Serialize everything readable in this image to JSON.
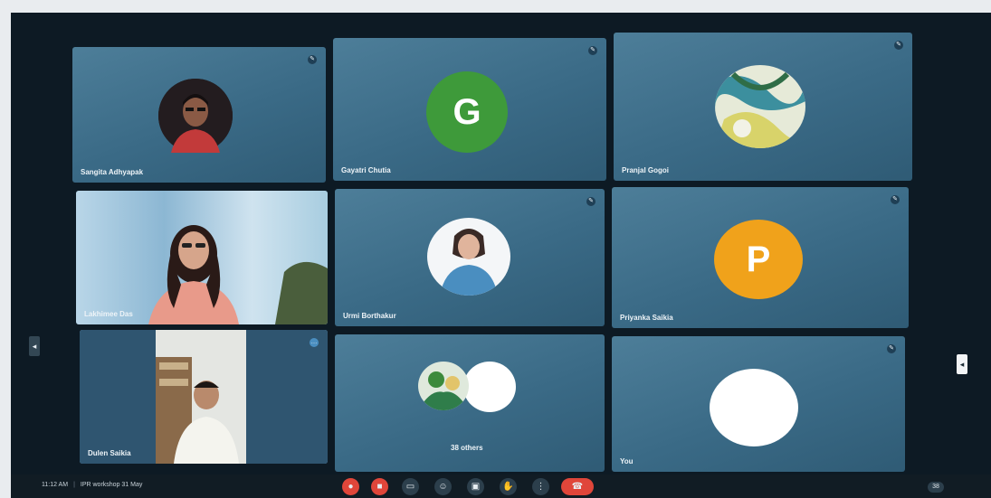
{
  "tiles": [
    {
      "name": "Sangita Adhyapak",
      "avatar_type": "photo"
    },
    {
      "name": "Gayatri Chutia",
      "avatar_type": "letter",
      "letter": "G",
      "color": "#3e9a3a"
    },
    {
      "name": "Pranjal Gogoi",
      "avatar_type": "photo"
    },
    {
      "name": "Lakhimee Das",
      "avatar_type": "video"
    },
    {
      "name": "Urmi Borthakur",
      "avatar_type": "photo"
    },
    {
      "name": "Priyanka Saikia",
      "avatar_type": "letter",
      "letter": "P",
      "color": "#f0a21b"
    },
    {
      "name": "Dulen Saikia",
      "avatar_type": "video"
    },
    {
      "name": "38 others",
      "avatar_type": "group"
    },
    {
      "name": "You",
      "avatar_type": "blank"
    }
  ],
  "bottom_bar": {
    "time": "11:12 AM",
    "separator": "|",
    "meeting_title": "IPR workshop 31 May",
    "chip_text": "38"
  },
  "icons": {
    "mic": "mic-icon",
    "left_arrow": "chevron-left-icon",
    "right_arrow": "chevron-right-icon"
  },
  "colors": {
    "hangup": "#e0463a",
    "tile": "#3f6f8b"
  }
}
